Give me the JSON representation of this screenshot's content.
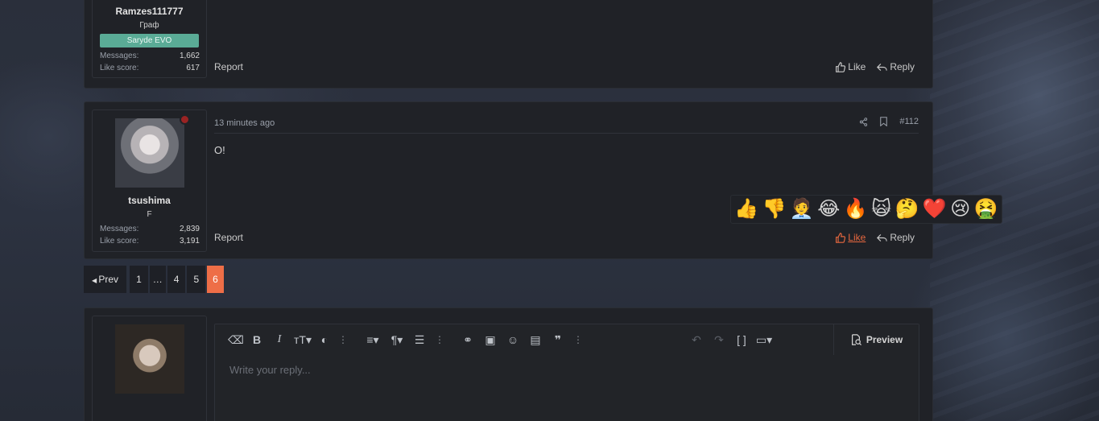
{
  "post1": {
    "username": "Ramzes111777",
    "usertitle": "Граф",
    "banner": "Saryde EVO",
    "stats": [
      {
        "label": "Messages:",
        "value": "1,662"
      },
      {
        "label": "Like score:",
        "value": "617"
      }
    ],
    "report": "Report",
    "like": "Like",
    "reply": "Reply"
  },
  "post2": {
    "username": "tsushima",
    "usertitle": "F",
    "time": "13 minutes ago",
    "post_number": "#112",
    "body": "O!",
    "stats": [
      {
        "label": "Messages:",
        "value": "2,839"
      },
      {
        "label": "Like score:",
        "value": "3,191"
      }
    ],
    "report": "Report",
    "like": "Like",
    "reply": "Reply",
    "like_active_color": "#e8683f"
  },
  "reactions": [
    "👍",
    "👎",
    "🧑‍💼",
    "😂",
    "🔥",
    "🙀",
    "🤔",
    "❤️",
    "😢",
    "🤮"
  ],
  "pagination": {
    "prev": "Prev",
    "pages": [
      "1",
      "…",
      "4",
      "5"
    ],
    "current": "6",
    "accent": "#ee6e47"
  },
  "editor": {
    "placeholder": "Write your reply...",
    "preview": "Preview",
    "toolbar_icons": [
      "eraser-icon",
      "bold-icon",
      "italic-icon",
      "text-size-icon",
      "palette-icon",
      "more-icon",
      "align-icon",
      "paragraph-icon",
      "list-icon",
      "more-icon",
      "link-icon",
      "image-icon",
      "smiley-icon",
      "media-icon",
      "quote-icon",
      "more-icon",
      "undo-icon",
      "redo-icon",
      "bbcode-icon",
      "drafts-icon"
    ]
  }
}
